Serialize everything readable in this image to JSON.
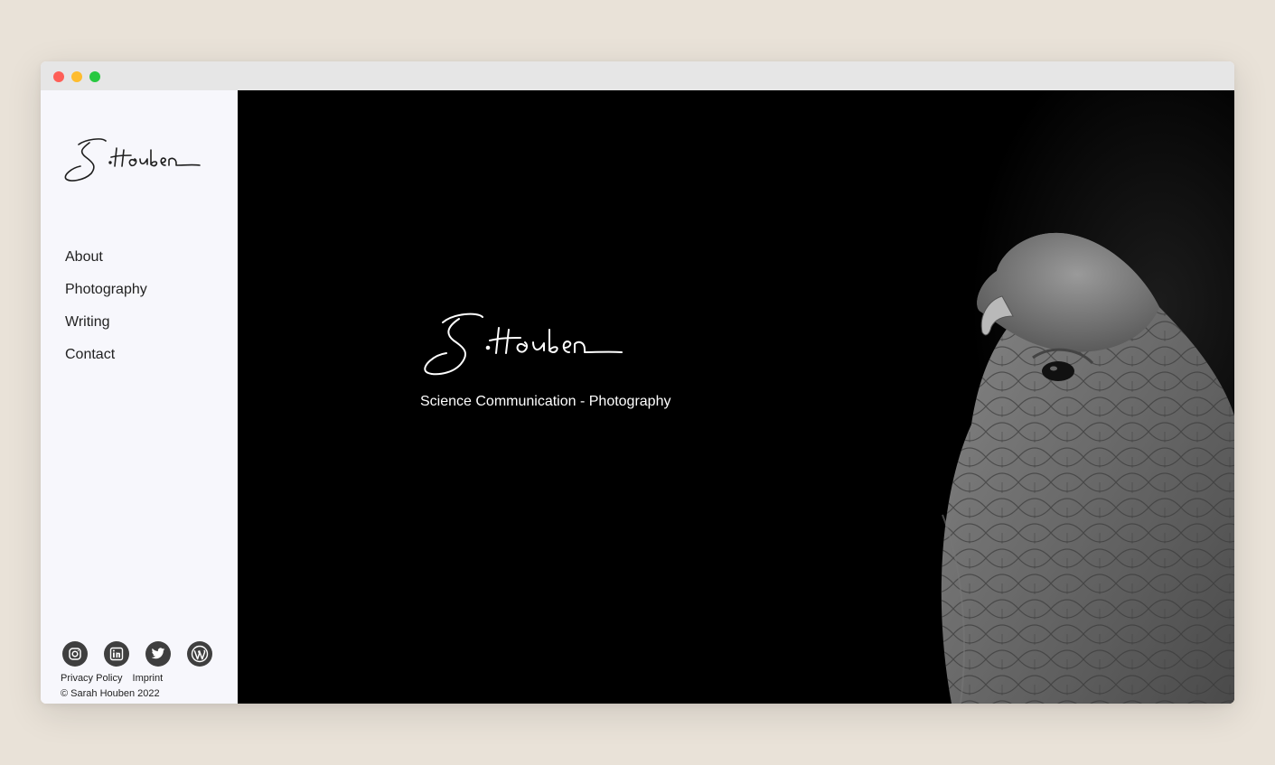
{
  "window": {
    "controls": [
      "close",
      "minimize",
      "maximize"
    ],
    "colors": {
      "close": "#fe5f57",
      "minimize": "#febc2e",
      "maximize": "#28c840"
    }
  },
  "sidebar": {
    "logo": "S. Houben",
    "nav": [
      {
        "label": "About"
      },
      {
        "label": "Photography"
      },
      {
        "label": "Writing"
      },
      {
        "label": "Contact"
      }
    ],
    "socials": [
      "instagram-icon",
      "linkedin-icon",
      "twitter-icon",
      "wordpress-icon"
    ],
    "footer": {
      "privacy": "Privacy Policy",
      "imprint": "Imprint",
      "copyright": "© Sarah Houben 2022"
    }
  },
  "hero": {
    "logo": "S. Houben",
    "tagline": "Science Communication - Photography",
    "image": "black-and-white-falcon-portrait"
  },
  "colors": {
    "page_bg": "#e9e2d8",
    "sidebar_bg": "#f7f7fc",
    "hero_bg": "#000000",
    "icon_bg": "#3f3f3f"
  }
}
